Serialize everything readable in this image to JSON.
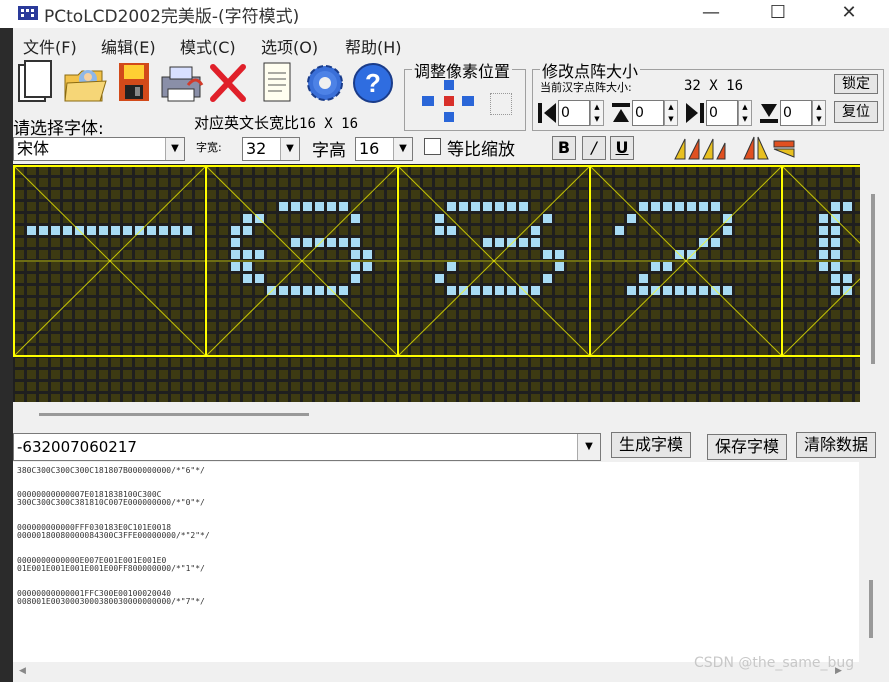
{
  "window": {
    "title": "PCtoLCD2002完美版-(字符模式)",
    "minimize": "—",
    "maximize": "☐",
    "close": "✕"
  },
  "menu": [
    "文件(F)",
    "编辑(E)",
    "模式(C)",
    "选项(O)",
    "帮助(H)"
  ],
  "toolbar": {
    "pixel_group_label": "调整像素位置",
    "dot_group_label": "修改点阵大小",
    "current_size_label": "当前汉字点阵大小:",
    "current_size_value": "32 X 16",
    "lock_button": "锁定",
    "reset_button": "复位",
    "spin_values": [
      "0",
      "0",
      "0",
      "0"
    ]
  },
  "font": {
    "select_label": "请选择字体:",
    "font_value": "宋体",
    "en_size_label": "对应英文长宽比",
    "en_size_value": "16 X 16",
    "width_label": "字宽:",
    "width_value": "32",
    "height_label": "字高",
    "height_value": "16",
    "proportional_label": "等比缩放",
    "bold": "B",
    "italic": "/",
    "underline": "U"
  },
  "command": {
    "input_value": "-632007060217",
    "generate_button": "生成字模",
    "save_button": "保存字模",
    "clear_button": "清除数据"
  },
  "output": [
    [
      "380C300C300C300C181807B000000000/*\"6\"*/"
    ],
    [
      "00000000000007E0181838100C300C",
      "300C300C300C381810C007E000000000/*\"0\"*/"
    ],
    [
      "000000000000FFF030183E0C101E0018",
      "00000180080000084300C3FFE00000000/*\"2\"*/"
    ],
    [
      "0000000000000E007E001E001E001E0",
      "01E001E001E001E001E00FF800000000/*\"1\"*/"
    ],
    [
      "00000000000001FFC300E00100020040",
      "008001E0030003000380030000000000/*\"7\"*/"
    ]
  ],
  "watermark": "CSDN @the_same_bug",
  "icons": [
    "new-file-icon",
    "open-folder-icon",
    "save-disk-icon",
    "print-icon",
    "delete-icon",
    "notepad-icon",
    "settings-gear-icon",
    "help-icon"
  ],
  "colors": {
    "grid_bg": "#1f1f1f",
    "cell_off": "#3d3a12",
    "cell_on": "#a9dcf4",
    "grid_line": "#ffff00"
  }
}
